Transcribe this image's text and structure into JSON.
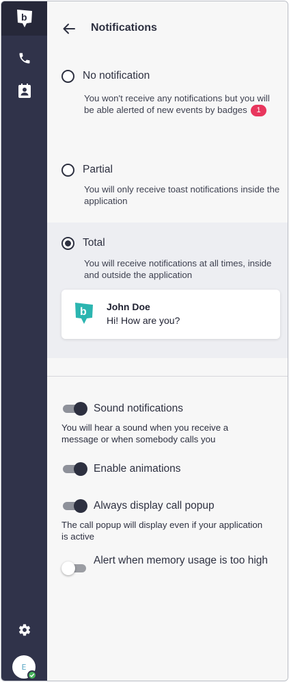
{
  "header": {
    "title": "Notifications"
  },
  "notification_modes": [
    {
      "label": "No notification",
      "description": "You won't receive any notifications but you will be able alerted of new events by badges",
      "badge": "1",
      "selected": false
    },
    {
      "label": "Partial",
      "description": "You will only receive toast notifications inside the application",
      "selected": false
    },
    {
      "label": "Total",
      "description": "You will receive notifications at all times, inside and outside the application",
      "selected": true
    }
  ],
  "preview": {
    "name": "John Doe",
    "message": "Hi! How are you?"
  },
  "toggles": [
    {
      "label": "Sound notifications",
      "description": "You will hear a sound when you receive a message or when somebody calls you",
      "on": true
    },
    {
      "label": "Enable animations",
      "on": true
    },
    {
      "label": "Always display call popup",
      "description": "The call popup will display even if your application is active",
      "on": true
    },
    {
      "label": "Alert when memory usage is too high",
      "on": false
    }
  ],
  "user": {
    "initial": "E"
  },
  "colors": {
    "sidebar": "#30334a",
    "accent_teal": "#2bb5b0",
    "badge": "#e8365d",
    "status_online": "#46b35a"
  },
  "icons": {
    "logo": "b-logo-icon",
    "calls": "phone-icon",
    "contacts": "contact-book-icon",
    "settings": "gear-icon",
    "back": "arrow-left-icon"
  }
}
